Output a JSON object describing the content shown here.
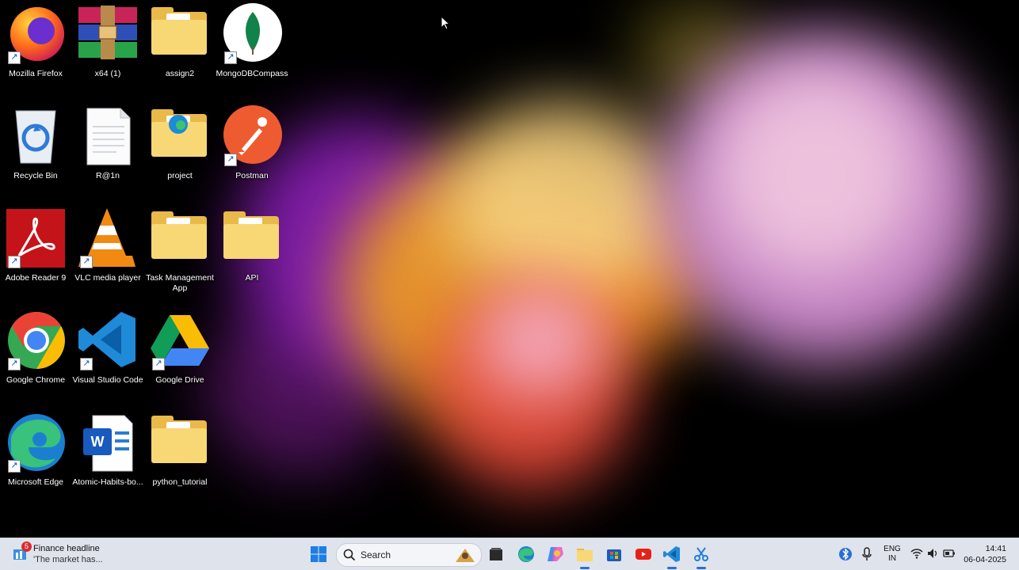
{
  "desktop": {
    "icons": [
      {
        "label": "Mozilla Firefox",
        "icon": "firefox-icon",
        "shortcut": true
      },
      {
        "label": "x64 (1)",
        "icon": "winrar-archive-icon",
        "shortcut": false
      },
      {
        "label": "assign2",
        "icon": "folder-icon",
        "shortcut": false
      },
      {
        "label": "MongoDBCompass",
        "icon": "mongodb-compass-icon",
        "shortcut": true
      },
      {
        "label": "Recycle Bin",
        "icon": "recycle-bin-icon",
        "shortcut": false
      },
      {
        "label": "R@1n",
        "icon": "text-file-icon",
        "shortcut": false
      },
      {
        "label": "project",
        "icon": "folder-icon",
        "shortcut": false
      },
      {
        "label": "Postman",
        "icon": "postman-icon",
        "shortcut": true
      },
      {
        "label": "Adobe Reader 9",
        "icon": "adobe-reader-icon",
        "shortcut": true
      },
      {
        "label": "VLC media player",
        "icon": "vlc-icon",
        "shortcut": true
      },
      {
        "label": "Task Management App",
        "icon": "folder-icon",
        "shortcut": false
      },
      {
        "label": "API",
        "icon": "folder-icon",
        "shortcut": false
      },
      {
        "label": "Google Chrome",
        "icon": "chrome-icon",
        "shortcut": true
      },
      {
        "label": "Visual Studio Code",
        "icon": "vscode-icon",
        "shortcut": true
      },
      {
        "label": "Google Drive",
        "icon": "google-drive-icon",
        "shortcut": true
      },
      {
        "label": "Microsoft Edge",
        "icon": "edge-icon",
        "shortcut": true
      },
      {
        "label": "Atomic-Habits-bo...",
        "icon": "word-document-icon",
        "shortcut": false
      },
      {
        "label": "python_tutorial",
        "icon": "folder-icon",
        "shortcut": false
      }
    ]
  },
  "taskbar": {
    "widget": {
      "badge": "5",
      "headline": "Finance headline",
      "subtext": "'The market has..."
    },
    "search": {
      "placeholder": "Search"
    },
    "pinned": [
      "start-icon",
      "file-explorer-task-icon",
      "edge-icon",
      "copilot-icon",
      "folder-icon",
      "microsoft-store-icon",
      "youtube-icon",
      "vscode-icon",
      "snipping-tool-icon"
    ],
    "tray": {
      "language_line1": "ENG",
      "language_line2": "IN",
      "time": "14:41",
      "date": "06-04-2025"
    }
  },
  "colors": {
    "taskbar_bg": "#dfe3ec",
    "folder": "#f8d775",
    "accent": "#2a6fd6"
  }
}
